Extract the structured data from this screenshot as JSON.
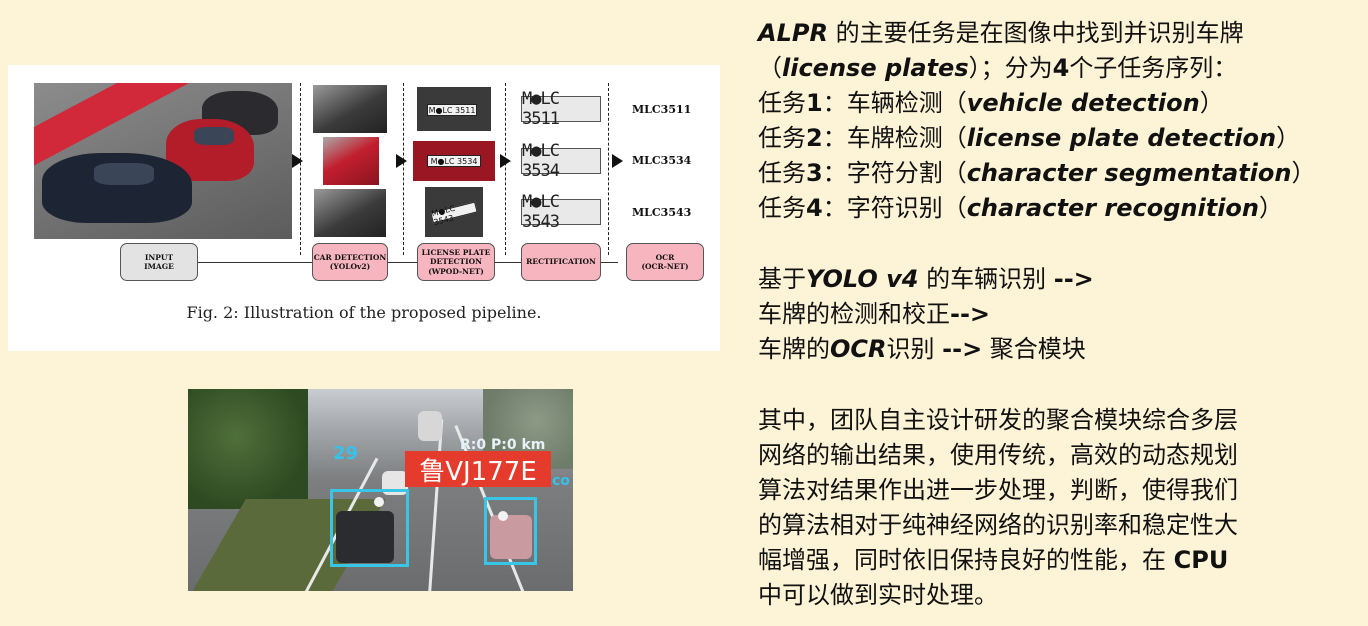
{
  "figure": {
    "caption": "Fig. 2: Illustration of the proposed pipeline.",
    "plates": [
      "M●LC 3511",
      "M●LC 3534",
      "M●LC 3543"
    ],
    "mini_plates": [
      "M●LC 3511",
      "M●LC 3534",
      "M●LC 3543"
    ],
    "ocr_results": [
      "MLC3511",
      "MLC3534",
      "MLC3543"
    ],
    "stages": [
      {
        "label": "INPUT\nIMAGE",
        "style": "grey"
      },
      {
        "label": "CAR DETECTION\n(YOLOv2)",
        "style": "pink"
      },
      {
        "label": "LICENSE PLATE\nDETECTION\n(WPOD-NET)",
        "style": "pink"
      },
      {
        "label": "RECTIFICATION",
        "style": "pink"
      },
      {
        "label": "OCR\n(OCR-NET)",
        "style": "pink"
      }
    ]
  },
  "road_image": {
    "plate_result": "鲁VJ177E",
    "hud_number": "29",
    "hud_speed": "R:0 P:0 km",
    "hud_co": "co",
    "detection_color": "#39c6e6",
    "plate_label_color": "#e53b2c"
  },
  "text": {
    "intro": [
      [
        {
          "t": "ALPR",
          "s": "em"
        },
        {
          "t": " 的主要任务是在图像中找到并识别车牌",
          "s": ""
        }
      ],
      [
        {
          "t": "（",
          "s": ""
        },
        {
          "t": "license plates",
          "s": "em"
        },
        {
          "t": "）；分为",
          "s": ""
        },
        {
          "t": "4",
          "s": "b"
        },
        {
          "t": "个子任务序列：",
          "s": ""
        }
      ],
      [
        {
          "t": "任务",
          "s": ""
        },
        {
          "t": "1",
          "s": "b"
        },
        {
          "t": "：车辆检测（",
          "s": ""
        },
        {
          "t": "vehicle detection",
          "s": "em"
        },
        {
          "t": "）",
          "s": ""
        }
      ],
      [
        {
          "t": "任务",
          "s": ""
        },
        {
          "t": "2",
          "s": "b"
        },
        {
          "t": "：车牌检测（",
          "s": ""
        },
        {
          "t": "license plate detection",
          "s": "em"
        },
        {
          "t": "）",
          "s": ""
        }
      ],
      [
        {
          "t": "任务",
          "s": ""
        },
        {
          "t": "3",
          "s": "b"
        },
        {
          "t": "：字符分割（",
          "s": ""
        },
        {
          "t": "character segmentation",
          "s": "em"
        },
        {
          "t": "）",
          "s": ""
        }
      ],
      [
        {
          "t": "任务",
          "s": ""
        },
        {
          "t": "4",
          "s": "b"
        },
        {
          "t": "：字符识别（",
          "s": ""
        },
        {
          "t": "character recognition",
          "s": "em"
        },
        {
          "t": "）",
          "s": ""
        }
      ]
    ],
    "flow": [
      [
        {
          "t": "基于",
          "s": ""
        },
        {
          "t": "YOLO v4",
          "s": "em"
        },
        {
          "t": " 的车辆识别 ",
          "s": ""
        },
        {
          "t": "-->",
          "s": "b"
        }
      ],
      [
        {
          "t": "车牌的检测和校正",
          "s": ""
        },
        {
          "t": "-->",
          "s": "b"
        }
      ],
      [
        {
          "t": "车牌的",
          "s": ""
        },
        {
          "t": "OCR",
          "s": "em"
        },
        {
          "t": "识别 ",
          "s": ""
        },
        {
          "t": "-->",
          "s": "b"
        },
        {
          "t": " 聚合模块",
          "s": ""
        }
      ]
    ],
    "para": [
      [
        {
          "t": "其中，团队自主设计研发的聚合模块综合多层",
          "s": ""
        }
      ],
      [
        {
          "t": "网络的输出结果，使用传统，高效的动态规划",
          "s": ""
        }
      ],
      [
        {
          "t": "算法对结果作出进一步处理，判断，使得我们",
          "s": ""
        }
      ],
      [
        {
          "t": "的算法相对于纯神经网络的识别率和稳定性大",
          "s": ""
        }
      ],
      [
        {
          "t": "幅增强，同时依旧保持良好的性能，在 ",
          "s": ""
        },
        {
          "t": "CPU",
          "s": "b"
        }
      ],
      [
        {
          "t": "中可以做到实时处理。",
          "s": ""
        }
      ]
    ]
  }
}
